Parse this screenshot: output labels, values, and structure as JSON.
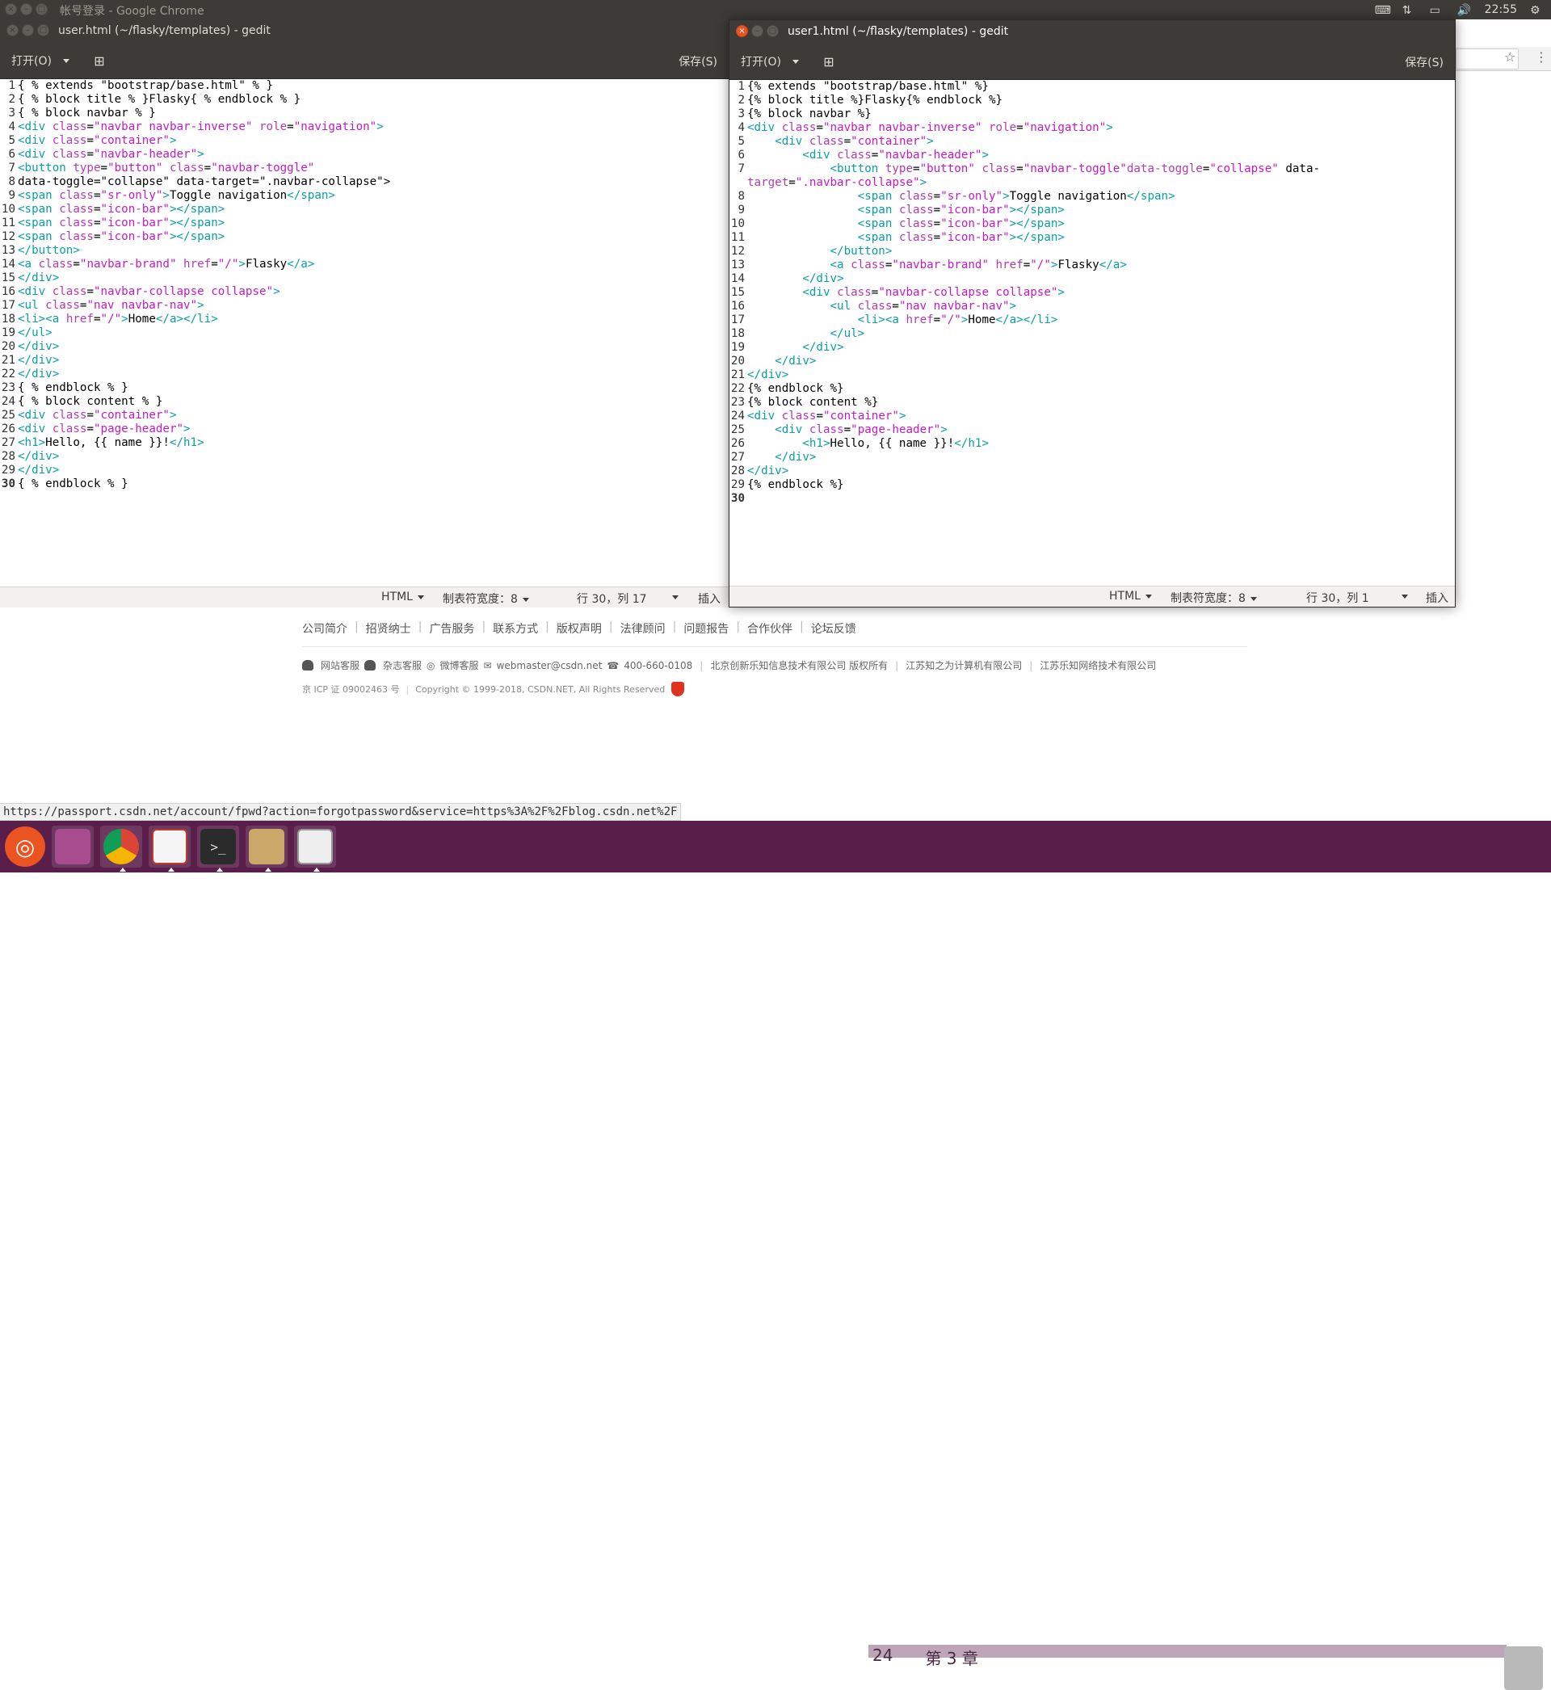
{
  "top_panel": {
    "window_title": "帐号登录 - Google Chrome",
    "time": "22:55"
  },
  "left_window": {
    "title": "user.html (~/flasky/templates) - gedit",
    "open_label": "打开(O)",
    "save_label": "保存(S)",
    "status": {
      "language": "HTML",
      "tab_width": "制表符宽度：8",
      "position": "行 30，列 17",
      "mode": "插入"
    },
    "lines": [
      {
        "n": "1",
        "html": "{ % extends \"bootstrap/base.html\" % }"
      },
      {
        "n": "2",
        "html": "{ % block title % }Flasky{ % endblock % }"
      },
      {
        "n": "3",
        "html": "{ % block navbar % }"
      },
      {
        "n": "4",
        "html": "<div class=\"navbar navbar-inverse\" role=\"navigation\">"
      },
      {
        "n": "5",
        "html": "<div class=\"container\">"
      },
      {
        "n": "6",
        "html": "<div class=\"navbar-header\">"
      },
      {
        "n": "7",
        "html": "<button type=\"button\" class=\"navbar-toggle\""
      },
      {
        "n": "8",
        "html": "data-toggle=\"collapse\" data-target=\".navbar-collapse\">"
      },
      {
        "n": "9",
        "html": "<span class=\"sr-only\">Toggle navigation</span>"
      },
      {
        "n": "10",
        "html": "<span class=\"icon-bar\"></span>"
      },
      {
        "n": "11",
        "html": "<span class=\"icon-bar\"></span>"
      },
      {
        "n": "12",
        "html": "<span class=\"icon-bar\"></span>"
      },
      {
        "n": "13",
        "html": "</button>"
      },
      {
        "n": "14",
        "html": "<a class=\"navbar-brand\" href=\"/\">Flasky</a>"
      },
      {
        "n": "15",
        "html": "</div>"
      },
      {
        "n": "16",
        "html": "<div class=\"navbar-collapse collapse\">"
      },
      {
        "n": "17",
        "html": "<ul class=\"nav navbar-nav\">"
      },
      {
        "n": "18",
        "html": "<li><a href=\"/\">Home</a></li>"
      },
      {
        "n": "19",
        "html": "</ul>"
      },
      {
        "n": "20",
        "html": "</div>"
      },
      {
        "n": "21",
        "html": "</div>"
      },
      {
        "n": "22",
        "html": "</div>"
      },
      {
        "n": "23",
        "html": "{ % endblock % }"
      },
      {
        "n": "24",
        "html": "{ % block content % }"
      },
      {
        "n": "25",
        "html": "<div class=\"container\">"
      },
      {
        "n": "26",
        "html": "<div class=\"page-header\">"
      },
      {
        "n": "27",
        "html": "<h1>Hello, {{ name }}!</h1>"
      },
      {
        "n": "28",
        "html": "</div>"
      },
      {
        "n": "29",
        "html": "</div>"
      },
      {
        "n": "30",
        "html": "{ % endblock % }"
      }
    ]
  },
  "right_window": {
    "title": "user1.html (~/flasky/templates) - gedit",
    "open_label": "打开(O)",
    "save_label": "保存(S)",
    "status": {
      "language": "HTML",
      "tab_width": "制表符宽度：8",
      "position": "行 30，列 1",
      "mode": "插入"
    },
    "lines": [
      {
        "n": "1",
        "html": "{% extends \"bootstrap/base.html\" %}"
      },
      {
        "n": "2",
        "html": "{% block title %}Flasky{% endblock %}"
      },
      {
        "n": "3",
        "html": "{% block navbar %}"
      },
      {
        "n": "4",
        "html": "<div class=\"navbar navbar-inverse\" role=\"navigation\">"
      },
      {
        "n": "5",
        "html": "    <div class=\"container\">"
      },
      {
        "n": "6",
        "html": "        <div class=\"navbar-header\">"
      },
      {
        "n": "7",
        "html": "            <button type=\"button\" class=\"navbar-toggle\"data-toggle=\"collapse\" data-"
      },
      {
        "n": "",
        "html": "target=\".navbar-collapse\">"
      },
      {
        "n": "8",
        "html": "                <span class=\"sr-only\">Toggle navigation</span>"
      },
      {
        "n": "9",
        "html": "                <span class=\"icon-bar\"></span>"
      },
      {
        "n": "10",
        "html": "                <span class=\"icon-bar\"></span>"
      },
      {
        "n": "11",
        "html": "                <span class=\"icon-bar\"></span>"
      },
      {
        "n": "12",
        "html": "            </button>"
      },
      {
        "n": "13",
        "html": "            <a class=\"navbar-brand\" href=\"/\">Flasky</a>"
      },
      {
        "n": "14",
        "html": "        </div>"
      },
      {
        "n": "15",
        "html": "        <div class=\"navbar-collapse collapse\">"
      },
      {
        "n": "16",
        "html": "            <ul class=\"nav navbar-nav\">"
      },
      {
        "n": "17",
        "html": "                <li><a href=\"/\">Home</a></li>"
      },
      {
        "n": "18",
        "html": "            </ul>"
      },
      {
        "n": "19",
        "html": "        </div>"
      },
      {
        "n": "20",
        "html": "    </div>"
      },
      {
        "n": "21",
        "html": "</div>"
      },
      {
        "n": "22",
        "html": "{% endblock %}"
      },
      {
        "n": "23",
        "html": "{% block content %}"
      },
      {
        "n": "24",
        "html": "<div class=\"container\">"
      },
      {
        "n": "25",
        "html": "    <div class=\"page-header\">"
      },
      {
        "n": "26",
        "html": "        <h1>Hello, {{ name }}!</h1>"
      },
      {
        "n": "27",
        "html": "    </div>"
      },
      {
        "n": "28",
        "html": "</div>"
      },
      {
        "n": "29",
        "html": "{% endblock %}"
      },
      {
        "n": "30",
        "html": ""
      }
    ]
  },
  "footer": {
    "links": [
      "公司简介",
      "招贤纳士",
      "广告服务",
      "联系方式",
      "版权声明",
      "法律顾问",
      "问题报告",
      "合作伙伴",
      "论坛反馈"
    ],
    "contacts": [
      "网站客服",
      "杂志客服",
      "微博客服",
      "webmaster@csdn.net",
      "400-660-0108",
      "北京创新乐知信息技术有限公司 版权所有",
      "江苏知之为计算机有限公司",
      "江苏乐知网络技术有限公司"
    ],
    "icp": "京 ICP 证 09002463 号",
    "copyright": "Copyright © 1999-2018, CSDN.NET, All Rights Reserved"
  },
  "status_url": "https://passport.csdn.net/account/fpwd?action=forgotpassword&service=https%3A%2F%2Fblog.csdn.net%2F",
  "taskbar": {
    "pdf_page": "24",
    "pdf_chapter": "第 3 章"
  },
  "colors": {
    "keyword": "#0a9ea6",
    "attr": "#b23cb2",
    "string": "#c21ac6",
    "panel": "#3c3b37",
    "launcher": "#5a1e4a",
    "accent": "#e95420"
  }
}
